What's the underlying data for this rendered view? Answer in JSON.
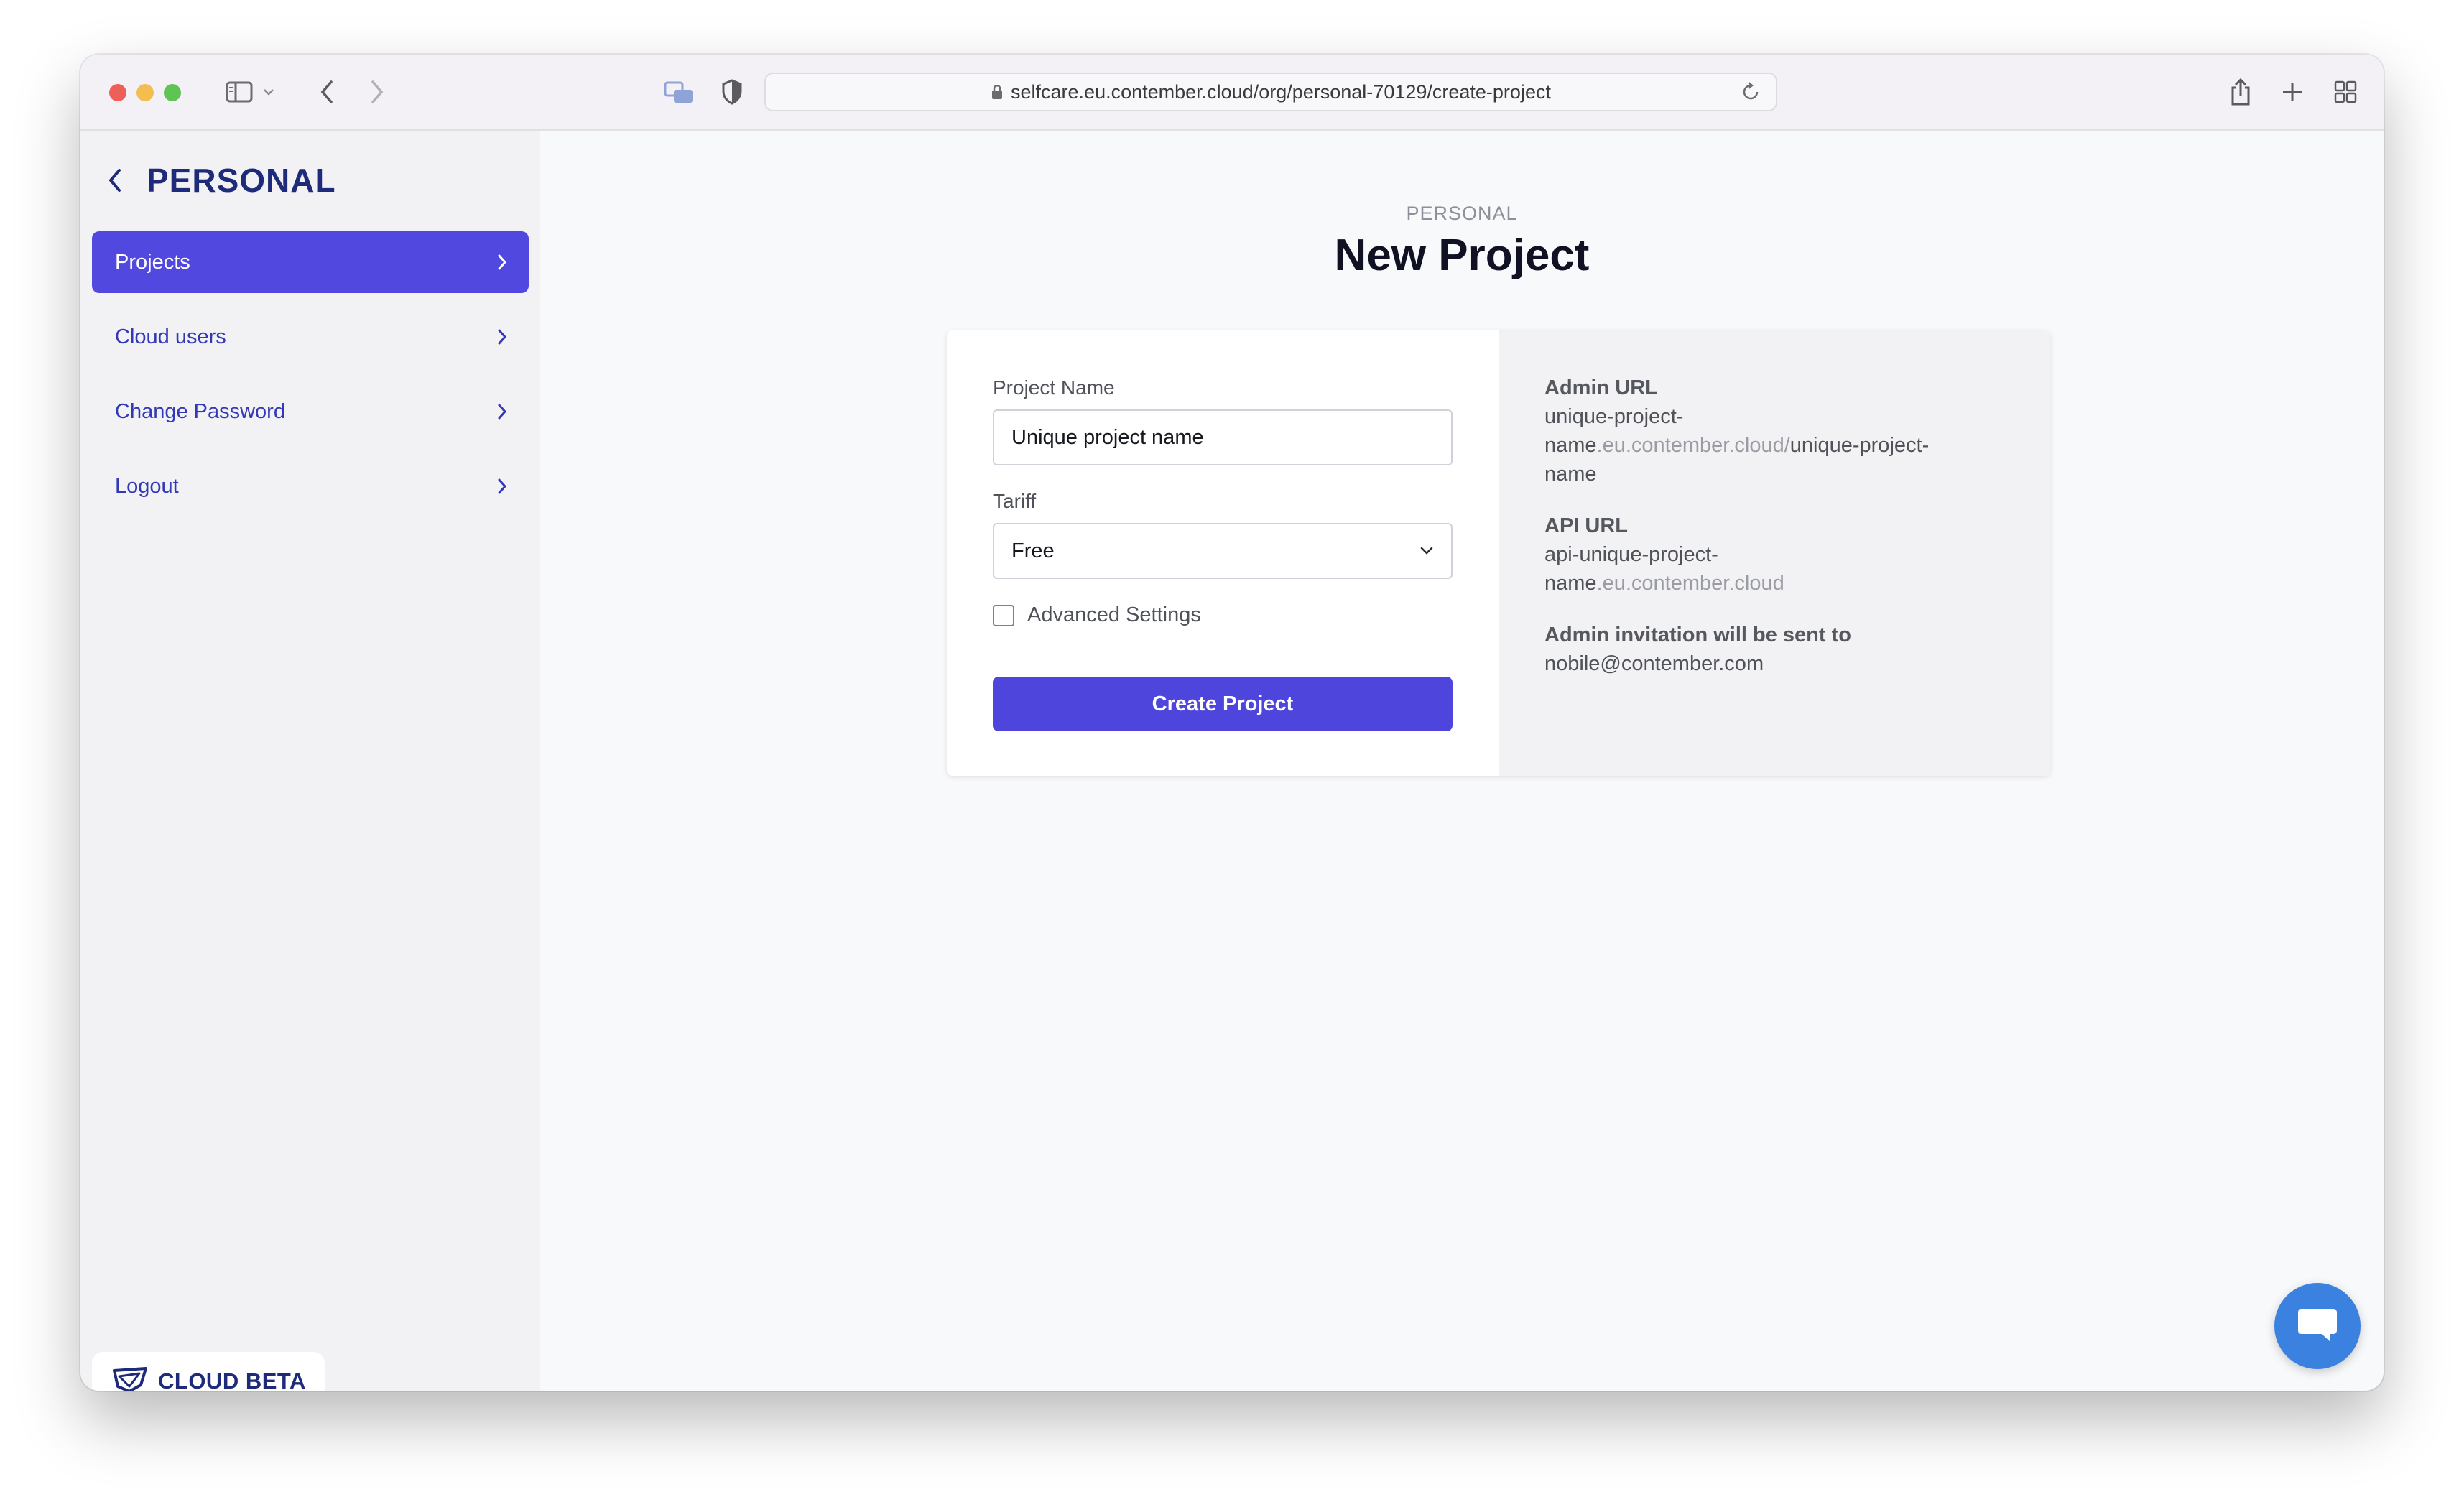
{
  "browser": {
    "url": "selfcare.eu.contember.cloud/org/personal-70129/create-project"
  },
  "sidebar": {
    "org_title": "PERSONAL",
    "items": [
      {
        "label": "Projects",
        "active": true
      },
      {
        "label": "Cloud users",
        "active": false
      },
      {
        "label": "Change Password",
        "active": false
      },
      {
        "label": "Logout",
        "active": false
      }
    ],
    "badge": "CLOUD BETA"
  },
  "main": {
    "eyebrow": "PERSONAL",
    "title": "New Project",
    "form": {
      "project_name_label": "Project Name",
      "project_name_value": "Unique project name",
      "tariff_label": "Tariff",
      "tariff_value": "Free",
      "advanced_label": "Advanced Settings",
      "advanced_checked": false,
      "submit_label": "Create Project"
    },
    "info": {
      "admin_url_label": "Admin URL",
      "admin_url_part1": "unique-project-",
      "admin_url_part2": "name",
      "admin_url_domain": ".eu.contember.cloud/",
      "admin_url_path1": "unique-project-",
      "admin_url_path2": "name",
      "api_url_label": "API URL",
      "api_url_part1": "api-unique-project-",
      "api_url_part2": "name",
      "api_url_domain": ".eu.contember.cloud",
      "invite_label": "Admin invitation will be sent to",
      "invite_email": "nobile@contember.com"
    }
  },
  "colors": {
    "accent": "#4e46dc",
    "nav_text": "#3338b8",
    "brand_dark": "#1e2a7a",
    "chat": "#3b82e0"
  },
  "icons": [
    "sidebar-icon",
    "chevron-down-icon",
    "back-icon",
    "forward-icon",
    "tab-preview-icon",
    "shield-icon",
    "lock-icon",
    "reload-icon",
    "share-icon",
    "plus-icon",
    "tab-grid-icon",
    "chevron-left-icon",
    "chevron-right-icon",
    "cloud-logo-icon",
    "chat-icon"
  ]
}
